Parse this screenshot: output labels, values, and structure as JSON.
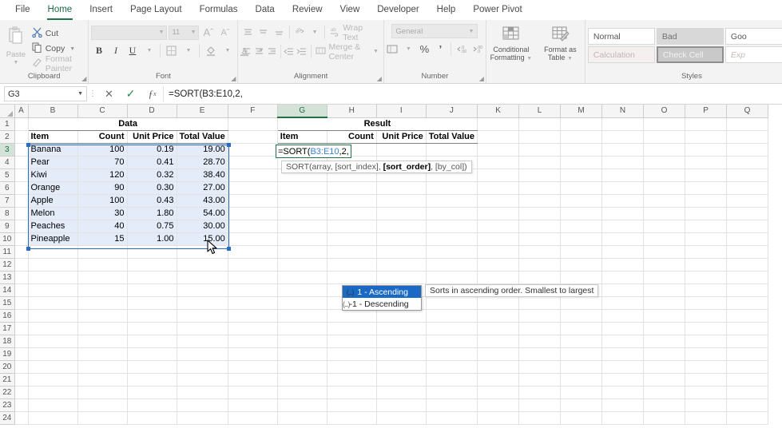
{
  "ribbon": {
    "tabs": [
      {
        "label": "File",
        "active": false
      },
      {
        "label": "Home",
        "active": true
      },
      {
        "label": "Insert",
        "active": false
      },
      {
        "label": "Page Layout",
        "active": false
      },
      {
        "label": "Formulas",
        "active": false
      },
      {
        "label": "Data",
        "active": false
      },
      {
        "label": "Review",
        "active": false
      },
      {
        "label": "View",
        "active": false
      },
      {
        "label": "Developer",
        "active": false
      },
      {
        "label": "Help",
        "active": false
      },
      {
        "label": "Power Pivot",
        "active": false
      }
    ],
    "clipboard": {
      "group_label": "Clipboard",
      "paste_label": "Paste",
      "cut_label": "Cut",
      "copy_label": "Copy",
      "format_painter_label": "Format Painter",
      "paste_icon": "clipboard-icon",
      "cut_icon": "scissors-icon",
      "copy_icon": "copy-icon",
      "format_painter_icon": "paintbrush-icon"
    },
    "font": {
      "group_label": "Font",
      "font_name": "",
      "font_size": "11",
      "grow_label": "A",
      "shrink_label": "A",
      "bold_label": "B",
      "italic_label": "I",
      "underline_label": "U",
      "borders_icon": "borders-icon",
      "fill_icon": "fill-color-icon",
      "fontcolor_icon": "font-color-icon"
    },
    "alignment": {
      "group_label": "Alignment",
      "wrap_text_label": "Wrap Text",
      "merge_center_label": "Merge & Center",
      "orientation_icon": "orientation-icon",
      "wrap_icon": "wrap-text-icon",
      "merge_icon": "merge-cells-icon",
      "indent_dec_icon": "decrease-indent-icon",
      "indent_inc_icon": "increase-indent-icon"
    },
    "number": {
      "group_label": "Number",
      "format": "General",
      "accounting_icon": "accounting-format-icon",
      "percent_label": "%",
      "comma_label": "9",
      "inc_dec_icon": "increase-decimal-icon",
      "dec_dec_icon": "decrease-decimal-icon"
    },
    "styles": {
      "group_label": "Styles",
      "conditional_formatting_label": "Conditional\nFormatting",
      "conditional_formatting_line1": "Conditional",
      "conditional_formatting_line2": "Formatting",
      "format_as_table_line1": "Format as",
      "format_as_table_line2": "Table",
      "gallery": [
        {
          "label": "Normal",
          "variant": "normal"
        },
        {
          "label": "Bad",
          "variant": "bad"
        },
        {
          "label": "Goo",
          "variant": "good"
        },
        {
          "label": "Calculation",
          "variant": "calc"
        },
        {
          "label": "Check Cell",
          "variant": "check"
        },
        {
          "label": "Exp",
          "variant": "exp"
        }
      ]
    }
  },
  "formula_bar": {
    "name_box": "G3",
    "cancel_icon": "cancel-icon",
    "enter_icon": "confirm-check-icon",
    "function_icon": "insert-function-icon",
    "formula": "=SORT(B3:E10,2,"
  },
  "grid": {
    "columns": [
      "A",
      "B",
      "C",
      "D",
      "E",
      "F",
      "G",
      "H",
      "I",
      "J",
      "K",
      "L",
      "M",
      "N",
      "O",
      "P",
      "Q"
    ],
    "selected_column": "G",
    "rows": [
      1,
      2,
      3,
      4,
      5,
      6,
      7,
      8,
      9,
      10,
      11,
      12,
      13,
      14,
      15,
      16,
      17,
      18,
      19,
      20,
      21,
      22,
      23,
      24
    ],
    "data_title": "Data",
    "result_title": "Result",
    "headers": {
      "item": "Item",
      "count": "Count",
      "unit_price": "Unit Price",
      "total_value": "Total Value"
    },
    "table": [
      {
        "item": "Banana",
        "count": "100",
        "unit_price": "0.19",
        "total_value": "19.00"
      },
      {
        "item": "Pear",
        "count": "70",
        "unit_price": "0.41",
        "total_value": "28.70"
      },
      {
        "item": "Kiwi",
        "count": "120",
        "unit_price": "0.32",
        "total_value": "38.40"
      },
      {
        "item": "Orange",
        "count": "90",
        "unit_price": "0.30",
        "total_value": "27.00"
      },
      {
        "item": "Apple",
        "count": "100",
        "unit_price": "0.43",
        "total_value": "43.00"
      },
      {
        "item": "Melon",
        "count": "30",
        "unit_price": "1.80",
        "total_value": "54.00"
      },
      {
        "item": "Peaches",
        "count": "40",
        "unit_price": "0.75",
        "total_value": "30.00"
      },
      {
        "item": "Pineapple",
        "count": "15",
        "unit_price": "1.00",
        "total_value": "15.00"
      }
    ]
  },
  "editing": {
    "formula_prefix": "=SORT(",
    "formula_ref": "B3:E10",
    "formula_rest": ",2,",
    "signature_pre": "SORT(array, [sort_index], ",
    "signature_bold": "[sort_order]",
    "signature_post": ", [by_col])",
    "autocomplete": [
      {
        "icon": "(...)",
        "label": "1 - Ascending",
        "selected": true
      },
      {
        "icon": "(...)",
        "label": "-1 - Descending",
        "selected": false
      }
    ],
    "description_tooltip": "Sorts in ascending order. Smallest to largest"
  },
  "colors": {
    "accent_green": "#217346",
    "selection_blue": "#2a6bc4",
    "highlight_blue": "#1a69c4",
    "ref_blue": "#3a7fd5",
    "selection_fill": "#e3ecf8"
  }
}
